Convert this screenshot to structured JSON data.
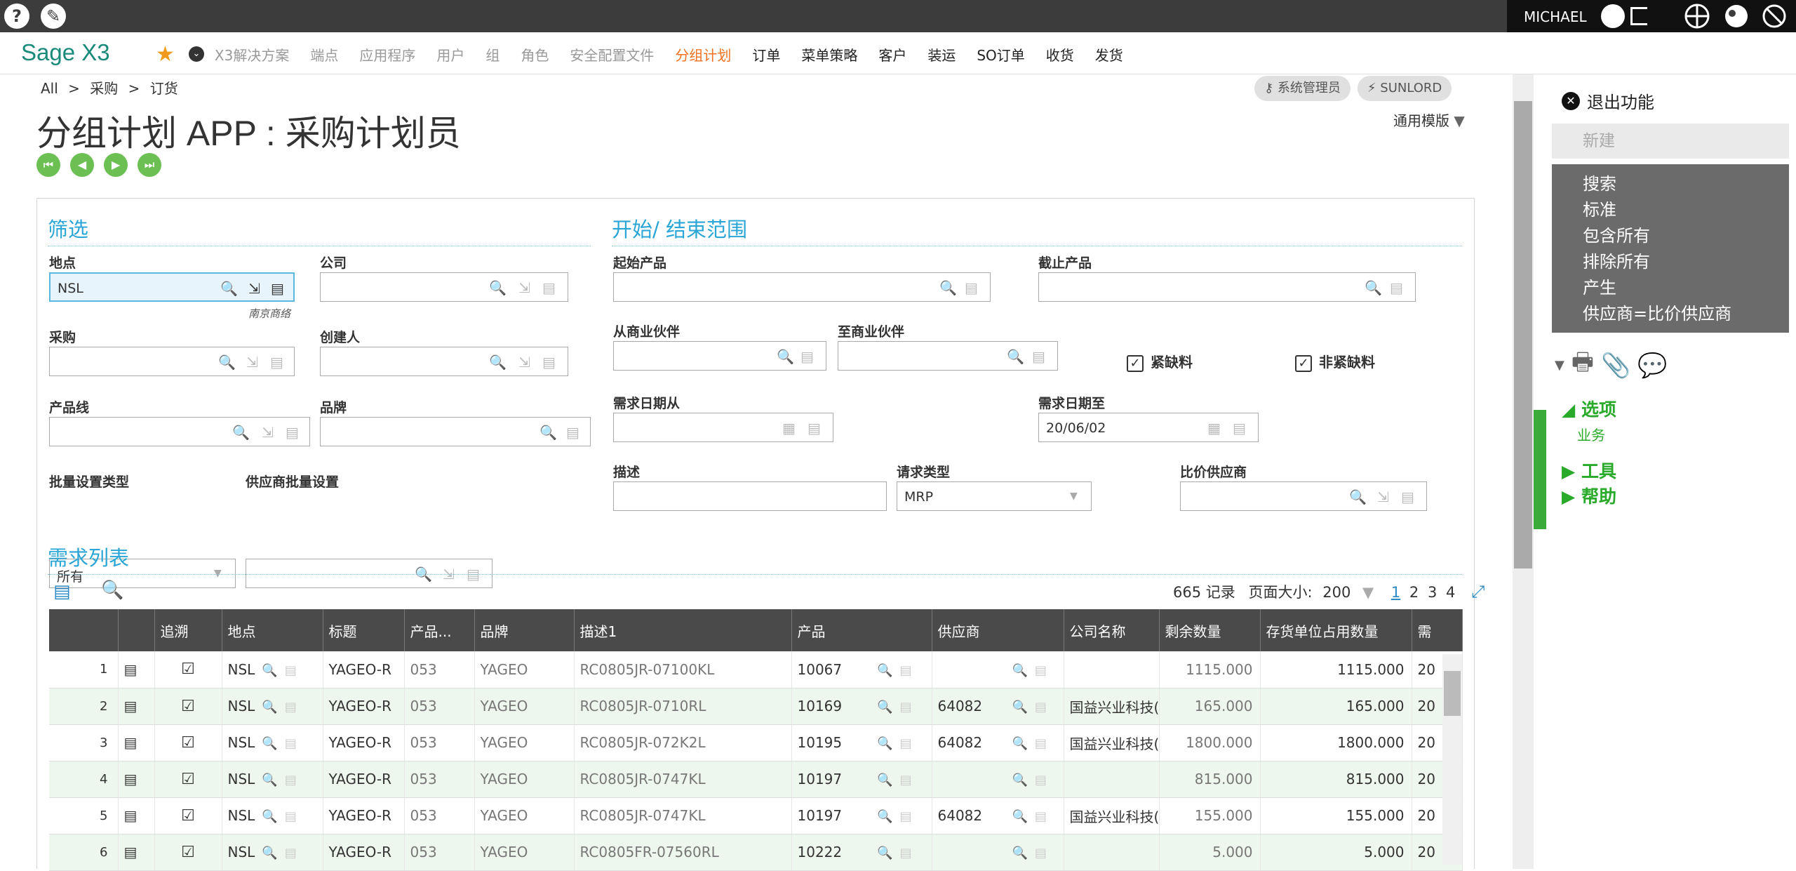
{
  "topbar": {
    "help_glyph": "?",
    "brush_glyph": "✎",
    "user": "MICHAEL"
  },
  "menubar": {
    "logo": "Sage X3",
    "star": "★",
    "chev": "⌄",
    "items": [
      "X3解决方案",
      "端点",
      "应用程序",
      "用户",
      "组",
      "角色",
      "安全配置文件",
      "分组计划",
      "订单",
      "菜单策略",
      "客户",
      "装运",
      "SO订单",
      "收货",
      "发货"
    ]
  },
  "breadcrumb": {
    "l0": "All",
    "l1": "采购",
    "l2": "订货",
    "sep": ">"
  },
  "pills": {
    "p1": "系统管理员",
    "p2": "SUNLORD"
  },
  "template": "通用模版",
  "page": {
    "title": "分组计划 APP : 采购计划员"
  },
  "filter": {
    "title": "筛选",
    "site_label": "地点",
    "site_value": "NSL",
    "site_sub": "南京商络",
    "company_label": "公司",
    "purchase_label": "采购",
    "creator_label": "创建人",
    "productline_label": "产品线",
    "brand_label": "品牌",
    "batchtype_label": "批量设置类型",
    "batchtype_value": "所有",
    "supplierbatch_label": "供应商批量设置"
  },
  "range": {
    "title": "开始/ 结束范围",
    "start_product_label": "起始产品",
    "end_product_label": "截止产品",
    "from_bp_label": "从商业伙伴",
    "to_bp_label": "至商业伙伴",
    "urgent_label": "紧缺料",
    "nonurgent_label": "非紧缺料",
    "datefrom_label": "需求日期从",
    "dateto_label": "需求日期至",
    "dateto_value": "20/06/02",
    "desc_label": "描述",
    "reqtype_label": "请求类型",
    "reqtype_value": "MRP",
    "compare_label": "比价供应商"
  },
  "grid": {
    "title": "需求列表",
    "records": "665 记录",
    "pagesize_label": "页面大小:",
    "pagesize_value": "200",
    "pages": [
      "1",
      "2",
      "3",
      "4"
    ],
    "columns": [
      "",
      "",
      "追溯",
      "地点",
      "标题",
      "产品...",
      "品牌",
      "描述1",
      "产品",
      "供应商",
      "公司名称",
      "剩余数量",
      "存货单位占用数量",
      "需"
    ],
    "rows": [
      {
        "n": "1",
        "site": "NSL",
        "title": "YAGEO-R",
        "pl": "053",
        "brand": "YAGEO",
        "desc": "RC0805JR-07100KL",
        "product": "10067",
        "supplier": "",
        "company": "",
        "qty": "1115.000",
        "stock": "1115.000",
        "last": "20"
      },
      {
        "n": "2",
        "site": "NSL",
        "title": "YAGEO-R",
        "pl": "053",
        "brand": "YAGEO",
        "desc": "RC0805JR-0710RL",
        "product": "10169",
        "supplier": "64082",
        "company": "国益兴业科技(",
        "qty": "165.000",
        "stock": "165.000",
        "last": "20"
      },
      {
        "n": "3",
        "site": "NSL",
        "title": "YAGEO-R",
        "pl": "053",
        "brand": "YAGEO",
        "desc": "RC0805JR-072K2L",
        "product": "10195",
        "supplier": "64082",
        "company": "国益兴业科技(",
        "qty": "1800.000",
        "stock": "1800.000",
        "last": "20"
      },
      {
        "n": "4",
        "site": "NSL",
        "title": "YAGEO-R",
        "pl": "053",
        "brand": "YAGEO",
        "desc": "RC0805JR-0747KL",
        "product": "10197",
        "supplier": "",
        "company": "",
        "qty": "815.000",
        "stock": "815.000",
        "last": "20"
      },
      {
        "n": "5",
        "site": "NSL",
        "title": "YAGEO-R",
        "pl": "053",
        "brand": "YAGEO",
        "desc": "RC0805JR-0747KL",
        "product": "10197",
        "supplier": "64082",
        "company": "国益兴业科技(",
        "qty": "155.000",
        "stock": "155.000",
        "last": "20"
      },
      {
        "n": "6",
        "site": "NSL",
        "title": "YAGEO-R",
        "pl": "053",
        "brand": "YAGEO",
        "desc": "RC0805FR-07560RL",
        "product": "10222",
        "supplier": "",
        "company": "",
        "qty": "5.000",
        "stock": "5.000",
        "last": "20"
      }
    ]
  },
  "right": {
    "exit": "退出功能",
    "new": "新建",
    "menu": [
      "搜索",
      "标准",
      "包含所有",
      "排除所有",
      "产生",
      "供应商=比价供应商"
    ],
    "options": "选项",
    "options_sub": "业务",
    "tools": "工具",
    "help": "帮助"
  }
}
